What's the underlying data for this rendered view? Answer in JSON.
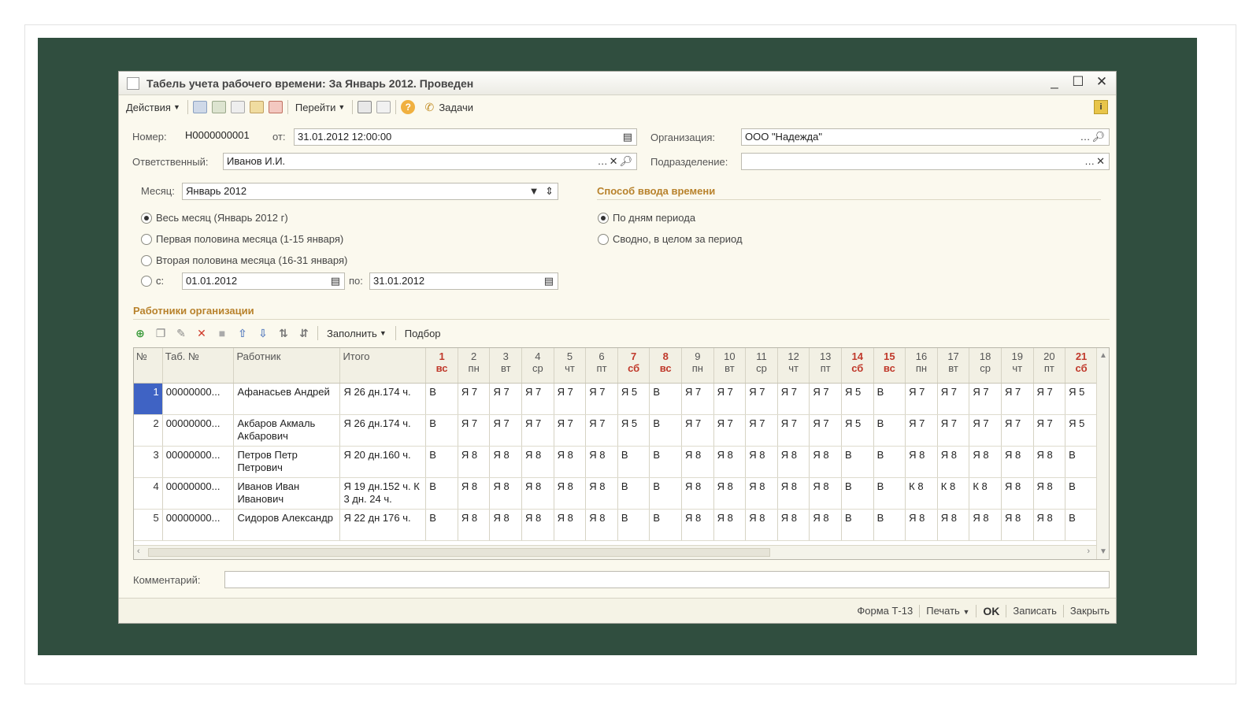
{
  "window": {
    "title": "Табель учета рабочего времени: За Январь 2012. Проведен",
    "minimize": "_",
    "maximize": "☐",
    "close": "✕"
  },
  "toolbar": {
    "actions_label": "Действия",
    "goto_label": "Перейти",
    "tasks_label": "Задачи",
    "help": "?",
    "info": "i"
  },
  "form": {
    "number_label": "Номер:",
    "number_value": "Н0000000001",
    "date_label": "от:",
    "date_value": "31.01.2012 12:00:00",
    "org_label": "Организация:",
    "org_value": "ООО \"Надежда\"",
    "responsible_label": "Ответственный:",
    "responsible_value": "Иванов И.И.",
    "dept_label": "Подразделение:",
    "dept_value": "",
    "month_label": "Месяц:",
    "month_value": "Январь 2012",
    "period_options": [
      "Весь месяц (Январь 2012 г)",
      "Первая половина месяца (1-15 января)",
      "Вторая половина месяца (16-31 января)",
      "с:"
    ],
    "period_selected": 0,
    "from_value": "01.01.2012",
    "to_label": "по:",
    "to_value": "31.01.2012",
    "input_method_title": "Способ ввода времени",
    "input_method_options": [
      "По дням периода",
      "Сводно, в целом за период"
    ],
    "input_method_selected": 0
  },
  "employees": {
    "section_title": "Работники организации",
    "fill_label": "Заполнить",
    "select_label": "Подбор",
    "columns": {
      "num": "№",
      "tab": "Таб. №",
      "worker": "Работник",
      "total": "Итого"
    },
    "days": [
      {
        "d": "1",
        "w": "вс",
        "weekend": true
      },
      {
        "d": "2",
        "w": "пн",
        "weekend": false
      },
      {
        "d": "3",
        "w": "вт",
        "weekend": false
      },
      {
        "d": "4",
        "w": "ср",
        "weekend": false
      },
      {
        "d": "5",
        "w": "чт",
        "weekend": false
      },
      {
        "d": "6",
        "w": "пт",
        "weekend": false
      },
      {
        "d": "7",
        "w": "сб",
        "weekend": true
      },
      {
        "d": "8",
        "w": "вс",
        "weekend": true
      },
      {
        "d": "9",
        "w": "пн",
        "weekend": false
      },
      {
        "d": "10",
        "w": "вт",
        "weekend": false
      },
      {
        "d": "11",
        "w": "ср",
        "weekend": false
      },
      {
        "d": "12",
        "w": "чт",
        "weekend": false
      },
      {
        "d": "13",
        "w": "пт",
        "weekend": false
      },
      {
        "d": "14",
        "w": "сб",
        "weekend": true
      },
      {
        "d": "15",
        "w": "вс",
        "weekend": true
      },
      {
        "d": "16",
        "w": "пн",
        "weekend": false
      },
      {
        "d": "17",
        "w": "вт",
        "weekend": false
      },
      {
        "d": "18",
        "w": "ср",
        "weekend": false
      },
      {
        "d": "19",
        "w": "чт",
        "weekend": false
      },
      {
        "d": "20",
        "w": "пт",
        "weekend": false
      },
      {
        "d": "21",
        "w": "сб",
        "weekend": true
      }
    ],
    "rows": [
      {
        "n": "1",
        "tab": "00000000...",
        "name": "Афанасьев Андрей",
        "total": "Я 26 дн.174 ч.",
        "days": [
          "В",
          "Я 7",
          "Я 7",
          "Я 7",
          "Я 7",
          "Я 7",
          "Я 5",
          "В",
          "Я 7",
          "Я 7",
          "Я 7",
          "Я 7",
          "Я 7",
          "Я 5",
          "В",
          "Я 7",
          "Я 7",
          "Я 7",
          "Я 7",
          "Я 7",
          "Я 5"
        ]
      },
      {
        "n": "2",
        "tab": "00000000...",
        "name": "Акбаров Акмаль Акбарович",
        "total": "Я 26 дн.174 ч.",
        "days": [
          "В",
          "Я 7",
          "Я 7",
          "Я 7",
          "Я 7",
          "Я 7",
          "Я 5",
          "В",
          "Я 7",
          "Я 7",
          "Я 7",
          "Я 7",
          "Я 7",
          "Я 5",
          "В",
          "Я 7",
          "Я 7",
          "Я 7",
          "Я 7",
          "Я 7",
          "Я 5"
        ]
      },
      {
        "n": "3",
        "tab": "00000000...",
        "name": "Петров Петр Петрович",
        "total": "Я 20 дн.160 ч.",
        "days": [
          "В",
          "Я 8",
          "Я 8",
          "Я 8",
          "Я 8",
          "Я 8",
          "В",
          "В",
          "Я 8",
          "Я 8",
          "Я 8",
          "Я 8",
          "Я 8",
          "В",
          "В",
          "Я 8",
          "Я 8",
          "Я 8",
          "Я 8",
          "Я 8",
          "В"
        ]
      },
      {
        "n": "4",
        "tab": "00000000...",
        "name": "Иванов Иван Иванович",
        "total": "Я 19 дн.152 ч. К 3 дн. 24 ч.",
        "days": [
          "В",
          "Я 8",
          "Я 8",
          "Я 8",
          "Я 8",
          "Я 8",
          "В",
          "В",
          "Я 8",
          "Я 8",
          "Я 8",
          "Я 8",
          "Я 8",
          "В",
          "В",
          "К 8",
          "К 8",
          "К 8",
          "Я 8",
          "Я 8",
          "В"
        ]
      },
      {
        "n": "5",
        "tab": "00000000...",
        "name": "Сидоров Александр",
        "total": "Я 22 дн 176 ч.",
        "days": [
          "В",
          "Я 8",
          "Я 8",
          "Я 8",
          "Я 8",
          "Я 8",
          "В",
          "В",
          "Я 8",
          "Я 8",
          "Я 8",
          "Я 8",
          "Я 8",
          "В",
          "В",
          "Я 8",
          "Я 8",
          "Я 8",
          "Я 8",
          "Я 8",
          "В"
        ]
      }
    ],
    "selected_row": 0
  },
  "comment": {
    "label": "Комментарий:",
    "value": ""
  },
  "footer": {
    "form_t13": "Форма Т-13",
    "print_label": "Печать",
    "ok_label": "OK",
    "save_label": "Записать",
    "close_label": "Закрыть"
  },
  "colors": {
    "backdrop": "#304e3f",
    "window_bg": "#fbf9ee",
    "section_title": "#b8822c",
    "weekend": "#c0392b",
    "selection": "#3f63c4"
  }
}
